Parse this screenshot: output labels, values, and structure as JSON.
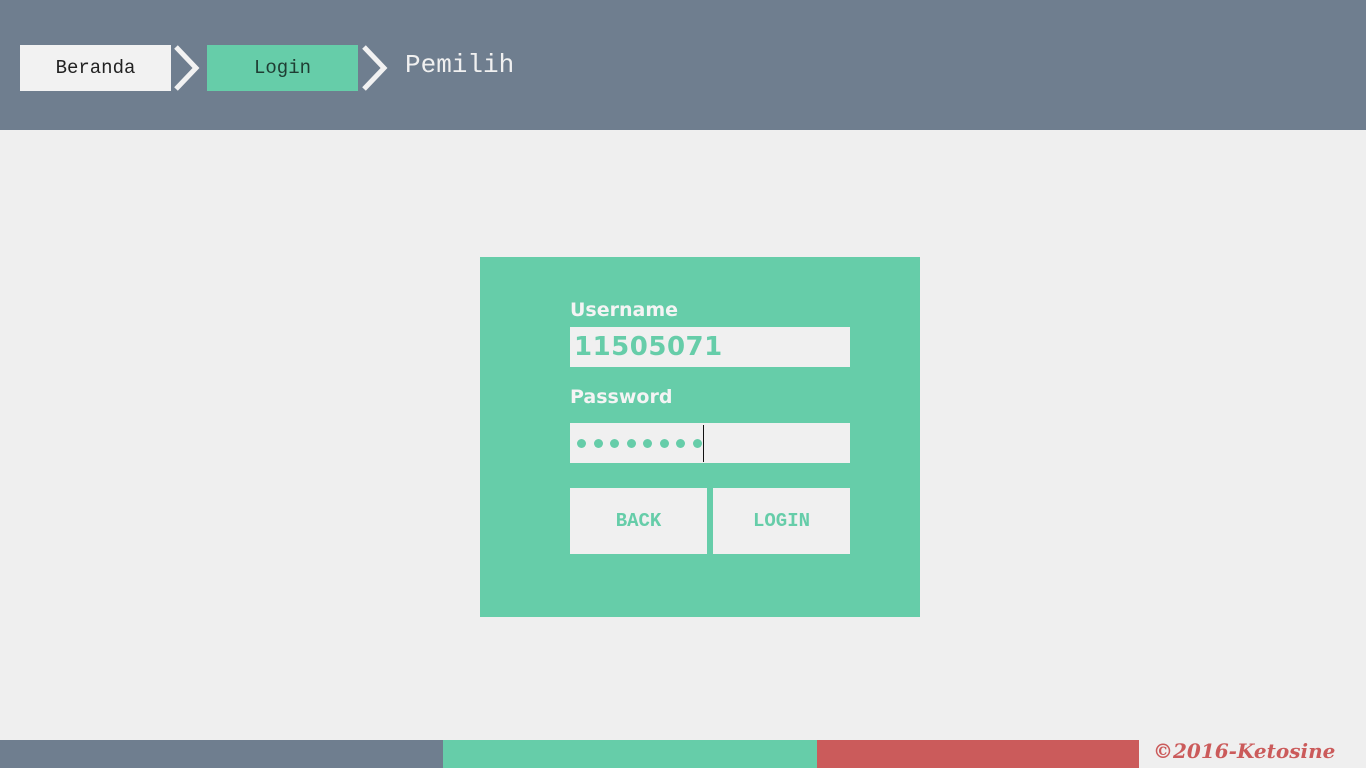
{
  "breadcrumb": {
    "items": [
      {
        "label": "Beranda"
      },
      {
        "label": "Login"
      }
    ],
    "current": "Pemilih"
  },
  "login_form": {
    "username_label": "Username",
    "username_value": "11505071",
    "password_label": "Password",
    "password_masked_length": 8,
    "back_label": "BACK",
    "login_label": "LOGIN"
  },
  "footer": {
    "copyright": "©2016-Ketosine",
    "colors": [
      "#6f7e8f",
      "#66cda9",
      "#cb5b5b"
    ]
  },
  "colors": {
    "header": "#6f7e8f",
    "accent": "#66cda9",
    "background": "#efefef",
    "danger": "#cb5b5b"
  },
  "icons": {
    "separator": "chevron-right-icon"
  }
}
